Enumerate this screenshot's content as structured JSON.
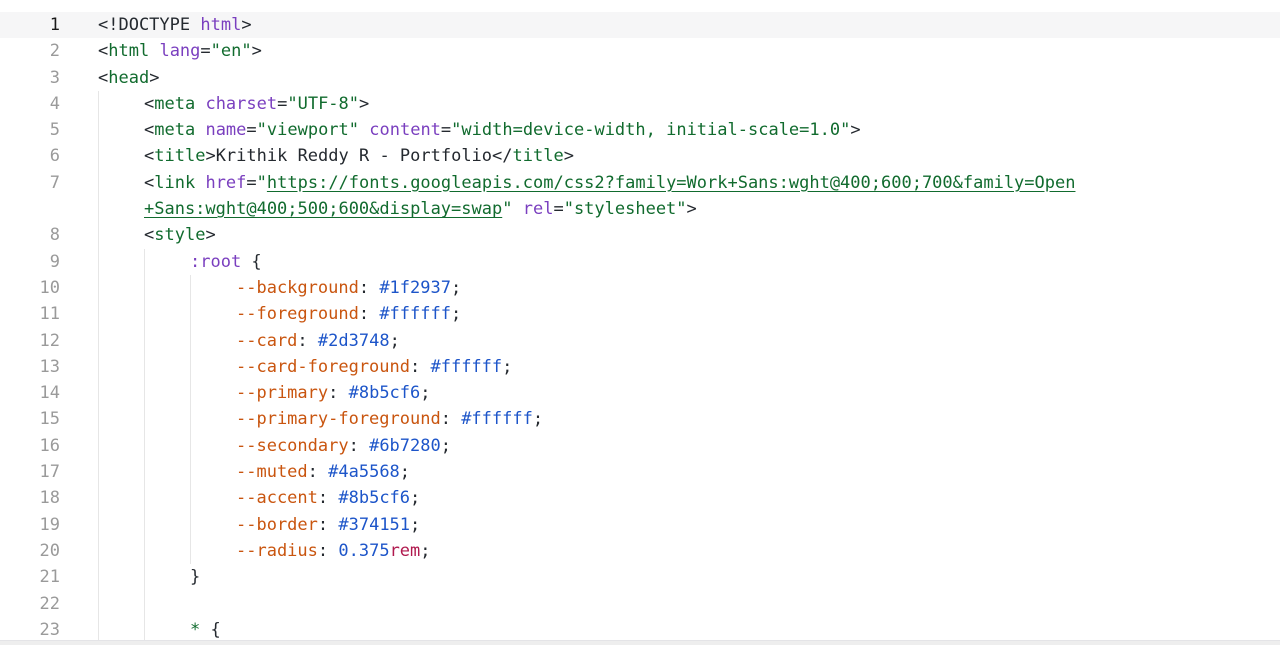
{
  "editor": {
    "lines": [
      {
        "number": "1",
        "active": true,
        "indent": 0,
        "tokens": [
          {
            "t": "<!DOCTYPE ",
            "c": "tok-punc"
          },
          {
            "t": "html",
            "c": "tok-attr"
          },
          {
            "t": ">",
            "c": "tok-punc"
          }
        ]
      },
      {
        "number": "2",
        "indent": 0,
        "tokens": [
          {
            "t": "<",
            "c": "tok-punc"
          },
          {
            "t": "html",
            "c": "tok-tag"
          },
          {
            "t": " ",
            "c": "tok-punc"
          },
          {
            "t": "lang",
            "c": "tok-attr"
          },
          {
            "t": "=",
            "c": "tok-punc"
          },
          {
            "t": "\"en\"",
            "c": "tok-str"
          },
          {
            "t": ">",
            "c": "tok-punc"
          }
        ]
      },
      {
        "number": "3",
        "indent": 0,
        "tokens": [
          {
            "t": "<",
            "c": "tok-punc"
          },
          {
            "t": "head",
            "c": "tok-tag"
          },
          {
            "t": ">",
            "c": "tok-punc"
          }
        ]
      },
      {
        "number": "4",
        "indent": 1,
        "tokens": [
          {
            "t": "<",
            "c": "tok-punc"
          },
          {
            "t": "meta",
            "c": "tok-tag"
          },
          {
            "t": " ",
            "c": "tok-punc"
          },
          {
            "t": "charset",
            "c": "tok-attr"
          },
          {
            "t": "=",
            "c": "tok-punc"
          },
          {
            "t": "\"UTF-8\"",
            "c": "tok-str"
          },
          {
            "t": ">",
            "c": "tok-punc"
          }
        ]
      },
      {
        "number": "5",
        "indent": 1,
        "tokens": [
          {
            "t": "<",
            "c": "tok-punc"
          },
          {
            "t": "meta",
            "c": "tok-tag"
          },
          {
            "t": " ",
            "c": "tok-punc"
          },
          {
            "t": "name",
            "c": "tok-attr"
          },
          {
            "t": "=",
            "c": "tok-punc"
          },
          {
            "t": "\"viewport\"",
            "c": "tok-str"
          },
          {
            "t": " ",
            "c": "tok-punc"
          },
          {
            "t": "content",
            "c": "tok-attr"
          },
          {
            "t": "=",
            "c": "tok-punc"
          },
          {
            "t": "\"width=device-width, initial-scale=1.0\"",
            "c": "tok-str"
          },
          {
            "t": ">",
            "c": "tok-punc"
          }
        ]
      },
      {
        "number": "6",
        "indent": 1,
        "tokens": [
          {
            "t": "<",
            "c": "tok-punc"
          },
          {
            "t": "title",
            "c": "tok-tag"
          },
          {
            "t": ">",
            "c": "tok-punc"
          },
          {
            "t": "Krithik Reddy R - Portfolio",
            "c": "tok-text"
          },
          {
            "t": "</",
            "c": "tok-punc"
          },
          {
            "t": "title",
            "c": "tok-tag"
          },
          {
            "t": ">",
            "c": "tok-punc"
          }
        ]
      },
      {
        "number": "7",
        "indent": 1,
        "wrapped": true,
        "tokens": [
          {
            "t": "<",
            "c": "tok-punc"
          },
          {
            "t": "link",
            "c": "tok-tag"
          },
          {
            "t": " ",
            "c": "tok-punc"
          },
          {
            "t": "href",
            "c": "tok-attr"
          },
          {
            "t": "=",
            "c": "tok-punc"
          },
          {
            "t": "\"",
            "c": "tok-str"
          },
          {
            "t": "https://fonts.googleapis.com/css2?family=Work+Sans:wght@400;600;700&family=Open",
            "c": "tok-url"
          }
        ],
        "wrap_tokens": [
          {
            "t": "+Sans:wght@400;500;600&display=swap",
            "c": "tok-url"
          },
          {
            "t": "\"",
            "c": "tok-str"
          },
          {
            "t": " ",
            "c": "tok-punc"
          },
          {
            "t": "rel",
            "c": "tok-attr"
          },
          {
            "t": "=",
            "c": "tok-punc"
          },
          {
            "t": "\"stylesheet\"",
            "c": "tok-str"
          },
          {
            "t": ">",
            "c": "tok-punc"
          }
        ]
      },
      {
        "number": "8",
        "indent": 1,
        "tokens": [
          {
            "t": "<",
            "c": "tok-punc"
          },
          {
            "t": "style",
            "c": "tok-tag"
          },
          {
            "t": ">",
            "c": "tok-punc"
          }
        ]
      },
      {
        "number": "9",
        "indent": 2,
        "tokens": [
          {
            "t": ":root",
            "c": "tok-selector"
          },
          {
            "t": " {",
            "c": "tok-punc"
          }
        ]
      },
      {
        "number": "10",
        "indent": 3,
        "tokens": [
          {
            "t": "--background",
            "c": "tok-prop"
          },
          {
            "t": ": ",
            "c": "tok-punc"
          },
          {
            "t": "#1f2937",
            "c": "tok-value"
          },
          {
            "t": ";",
            "c": "tok-punc"
          }
        ]
      },
      {
        "number": "11",
        "indent": 3,
        "tokens": [
          {
            "t": "--foreground",
            "c": "tok-prop"
          },
          {
            "t": ": ",
            "c": "tok-punc"
          },
          {
            "t": "#ffffff",
            "c": "tok-value"
          },
          {
            "t": ";",
            "c": "tok-punc"
          }
        ]
      },
      {
        "number": "12",
        "indent": 3,
        "tokens": [
          {
            "t": "--card",
            "c": "tok-prop"
          },
          {
            "t": ": ",
            "c": "tok-punc"
          },
          {
            "t": "#2d3748",
            "c": "tok-value"
          },
          {
            "t": ";",
            "c": "tok-punc"
          }
        ]
      },
      {
        "number": "13",
        "indent": 3,
        "tokens": [
          {
            "t": "--card-foreground",
            "c": "tok-prop"
          },
          {
            "t": ": ",
            "c": "tok-punc"
          },
          {
            "t": "#ffffff",
            "c": "tok-value"
          },
          {
            "t": ";",
            "c": "tok-punc"
          }
        ]
      },
      {
        "number": "14",
        "indent": 3,
        "tokens": [
          {
            "t": "--primary",
            "c": "tok-prop"
          },
          {
            "t": ": ",
            "c": "tok-punc"
          },
          {
            "t": "#8b5cf6",
            "c": "tok-value"
          },
          {
            "t": ";",
            "c": "tok-punc"
          }
        ]
      },
      {
        "number": "15",
        "indent": 3,
        "tokens": [
          {
            "t": "--primary-foreground",
            "c": "tok-prop"
          },
          {
            "t": ": ",
            "c": "tok-punc"
          },
          {
            "t": "#ffffff",
            "c": "tok-value"
          },
          {
            "t": ";",
            "c": "tok-punc"
          }
        ]
      },
      {
        "number": "16",
        "indent": 3,
        "tokens": [
          {
            "t": "--secondary",
            "c": "tok-prop"
          },
          {
            "t": ": ",
            "c": "tok-punc"
          },
          {
            "t": "#6b7280",
            "c": "tok-value"
          },
          {
            "t": ";",
            "c": "tok-punc"
          }
        ]
      },
      {
        "number": "17",
        "indent": 3,
        "tokens": [
          {
            "t": "--muted",
            "c": "tok-prop"
          },
          {
            "t": ": ",
            "c": "tok-punc"
          },
          {
            "t": "#4a5568",
            "c": "tok-value"
          },
          {
            "t": ";",
            "c": "tok-punc"
          }
        ]
      },
      {
        "number": "18",
        "indent": 3,
        "tokens": [
          {
            "t": "--accent",
            "c": "tok-prop"
          },
          {
            "t": ": ",
            "c": "tok-punc"
          },
          {
            "t": "#8b5cf6",
            "c": "tok-value"
          },
          {
            "t": ";",
            "c": "tok-punc"
          }
        ]
      },
      {
        "number": "19",
        "indent": 3,
        "tokens": [
          {
            "t": "--border",
            "c": "tok-prop"
          },
          {
            "t": ": ",
            "c": "tok-punc"
          },
          {
            "t": "#374151",
            "c": "tok-value"
          },
          {
            "t": ";",
            "c": "tok-punc"
          }
        ]
      },
      {
        "number": "20",
        "indent": 3,
        "tokens": [
          {
            "t": "--radius",
            "c": "tok-prop"
          },
          {
            "t": ": ",
            "c": "tok-punc"
          },
          {
            "t": "0.375",
            "c": "tok-value"
          },
          {
            "t": "rem",
            "c": "tok-unit"
          },
          {
            "t": ";",
            "c": "tok-punc"
          }
        ]
      },
      {
        "number": "21",
        "indent": 2,
        "tokens": [
          {
            "t": "}",
            "c": "tok-punc"
          }
        ]
      },
      {
        "number": "22",
        "indent": 2,
        "tokens": []
      },
      {
        "number": "23",
        "indent": 2,
        "tokens": [
          {
            "t": "*",
            "c": "tok-tag"
          },
          {
            "t": " {",
            "c": "tok-punc"
          }
        ]
      }
    ]
  }
}
